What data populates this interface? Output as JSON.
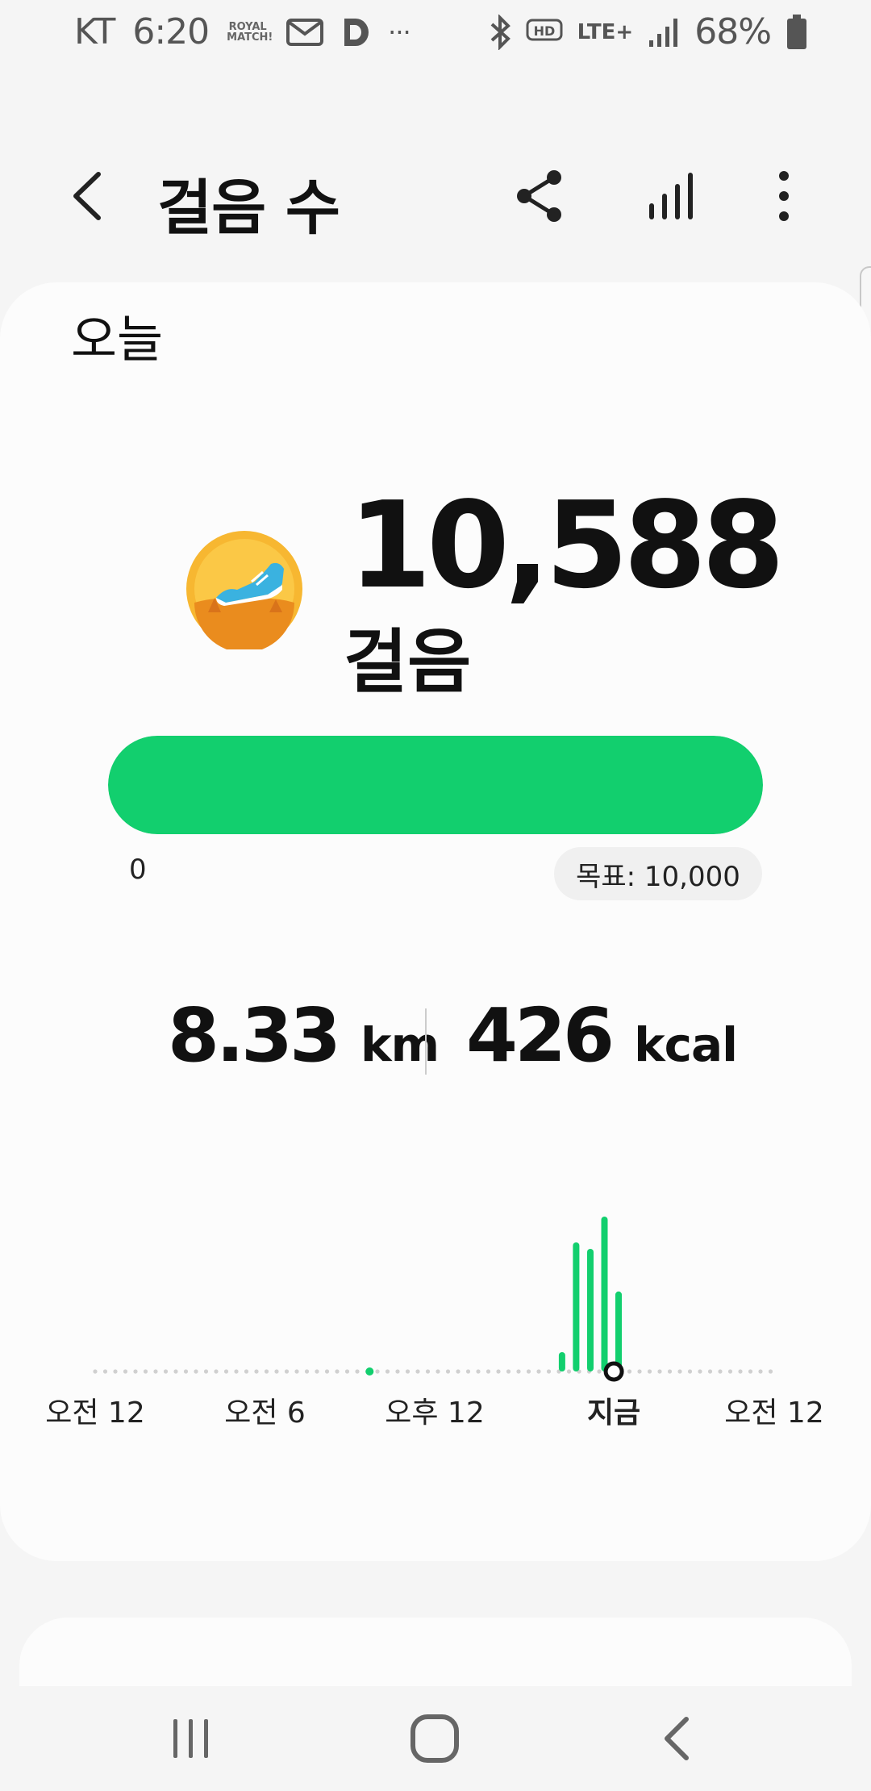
{
  "status_bar": {
    "carrier": "KT",
    "time": "6:20",
    "royal_match": "ROYAL MATCH!",
    "more": "···",
    "network": "LTE+",
    "battery": "68%",
    "battery_level": 0.68
  },
  "header": {
    "title": "걸음 수",
    "back_icon": "chevron-left-icon",
    "share_icon": "share-icon",
    "chart_icon": "bar-chart-icon",
    "more_icon": "more-vertical-icon"
  },
  "card": {
    "period": "오늘",
    "steps_value": "10,588",
    "steps_unit": "걸음",
    "progress": {
      "min": "0",
      "goal": "목표: 10,000",
      "fraction": 1.0
    },
    "distance_value": "8.33",
    "distance_unit": "km",
    "calories_value": "426",
    "calories_unit": "kcal"
  },
  "colors": {
    "accent": "#12cf6e",
    "badge": "#f5a623",
    "shoe": "#3ab2e0"
  },
  "chart_data": {
    "type": "bar",
    "x_labels": [
      "오전 12",
      "오전 6",
      "오후 12",
      "지금",
      "오전 12"
    ],
    "x_hours": [
      0,
      6,
      12,
      18.33,
      24
    ],
    "xlim": [
      0,
      24
    ],
    "bars": [
      {
        "hour": 16.5,
        "value": 15
      },
      {
        "hour": 17.0,
        "value": 100
      },
      {
        "hour": 17.5,
        "value": 95
      },
      {
        "hour": 18.0,
        "value": 120
      },
      {
        "hour": 18.5,
        "value": 62
      }
    ],
    "ylim": [
      0,
      125
    ],
    "earlier_activity_hour": 9.7,
    "current_hour": 18.33
  },
  "nav_bar": {
    "recents_icon": "recents-icon",
    "home_icon": "home-icon",
    "back_icon": "back-icon"
  }
}
